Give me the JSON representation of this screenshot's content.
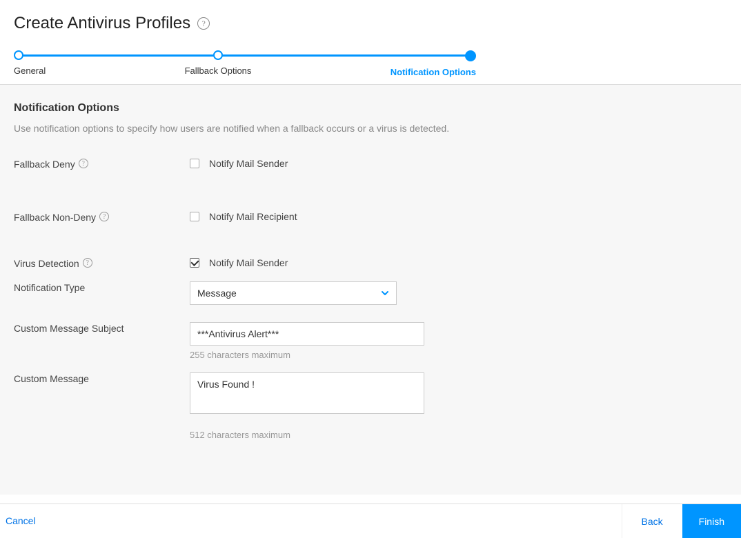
{
  "page": {
    "title": "Create Antivirus Profiles"
  },
  "wizard": {
    "steps": [
      {
        "label": "General",
        "active": false
      },
      {
        "label": "Fallback Options",
        "active": false
      },
      {
        "label": "Notification Options",
        "active": true
      }
    ]
  },
  "section": {
    "title": "Notification Options",
    "description": "Use notification options to specify how users are notified when a fallback occurs or a virus is detected."
  },
  "fields": {
    "fallback_deny": {
      "label": "Fallback Deny",
      "checkbox_label": "Notify Mail Sender",
      "checked": false
    },
    "fallback_non_deny": {
      "label": "Fallback Non-Deny",
      "checkbox_label": "Notify Mail Recipient",
      "checked": false
    },
    "virus_detection": {
      "label": "Virus Detection",
      "checkbox_label": "Notify Mail Sender",
      "checked": true
    },
    "notification_type": {
      "label": "Notification Type",
      "value": "Message"
    },
    "custom_subject": {
      "label": "Custom Message Subject",
      "value": "***Antivirus Alert***",
      "hint": "255 characters maximum"
    },
    "custom_message": {
      "label": "Custom Message",
      "value": "Virus Found !",
      "hint": "512 characters maximum"
    }
  },
  "actions": {
    "cancel": "Cancel",
    "back": "Back",
    "finish": "Finish"
  }
}
